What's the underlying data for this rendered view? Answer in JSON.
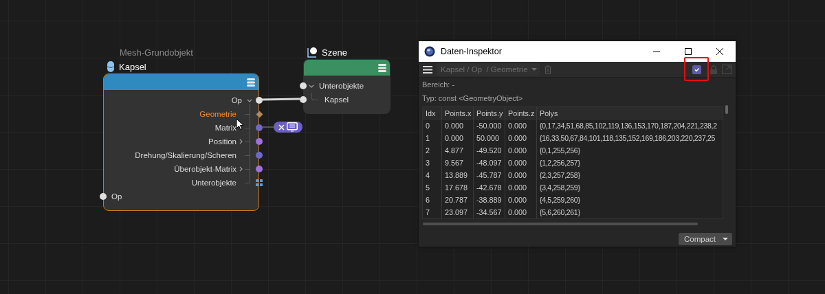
{
  "canvas": {
    "nodes": [
      {
        "kind": "object",
        "subtitle": "Mesh-Grundobjekt",
        "title": "Kapsel",
        "color": "#2f8ac0",
        "selected": true,
        "outputs": [
          {
            "label": "Op",
            "expanded": true,
            "kind": "dot",
            "color": "#e0e0e0",
            "selected": false,
            "children": [
              {
                "label": "Geometrie",
                "kind": "diamond",
                "color": "#b08a5e",
                "selected": true
              },
              {
                "label": "Matrix",
                "kind": "dot",
                "color": "#7068c8",
                "selected": false
              },
              {
                "label": "Position",
                "expanded": false,
                "kind": "dot",
                "color": "#a070e0",
                "selected": false
              },
              {
                "label": "Drehung/Skalierung/Scheren",
                "kind": "dot",
                "color": "#7068c8",
                "selected": false
              },
              {
                "label": "Überobjekt-Matrix",
                "expanded": false,
                "kind": "dot",
                "color": "#a070e0",
                "selected": false
              },
              {
                "label": "Unterobjekte",
                "kind": "grid",
                "color": "#5a9ad8",
                "selected": false
              }
            ]
          }
        ],
        "inputs": [
          {
            "label": "Op"
          }
        ]
      },
      {
        "kind": "scene",
        "title": "Szene",
        "color": "#3a9060",
        "selected": false,
        "inputs": [
          {
            "label": "Unterobjekte",
            "expanded": true,
            "children": [
              {
                "label": "Kapsel"
              }
            ]
          }
        ]
      }
    ]
  },
  "inspector": {
    "title": "Daten-Inspektor",
    "path": "Kapsel / Op  / Geometrie",
    "checked": true,
    "highlighted": true,
    "range": "Bereich: -",
    "type": "Typ: const <GeometryObject>",
    "table": {
      "columns": [
        "Idx",
        "Points.x",
        "Points.y",
        "Points.z",
        "Polys"
      ],
      "rows": [
        [
          "0",
          "0.000",
          "-50.000",
          "0.000",
          "{0,17,34,51,68,85,102,119,136,153,170,187,204,221,238,2"
        ],
        [
          "1",
          "0.000",
          "50.000",
          "0.000",
          "{16,33,50,67,84,101,118,135,152,169,186,203,220,237,25"
        ],
        [
          "2",
          "4.877",
          "-49.520",
          "0.000",
          "{0,1,255,256}"
        ],
        [
          "3",
          "9.567",
          "-48.097",
          "0.000",
          "{1,2,256,257}"
        ],
        [
          "4",
          "13.889",
          "-45.787",
          "0.000",
          "{2,3,257,258}"
        ],
        [
          "5",
          "17.678",
          "-42.678",
          "0.000",
          "{3,4,258,259}"
        ],
        [
          "6",
          "20.787",
          "-38.889",
          "0.000",
          "{4,5,259,260}"
        ],
        [
          "7",
          "23.097",
          "-34.567",
          "0.000",
          "{5,6,260,261}"
        ]
      ]
    },
    "view_mode": "Compact"
  }
}
